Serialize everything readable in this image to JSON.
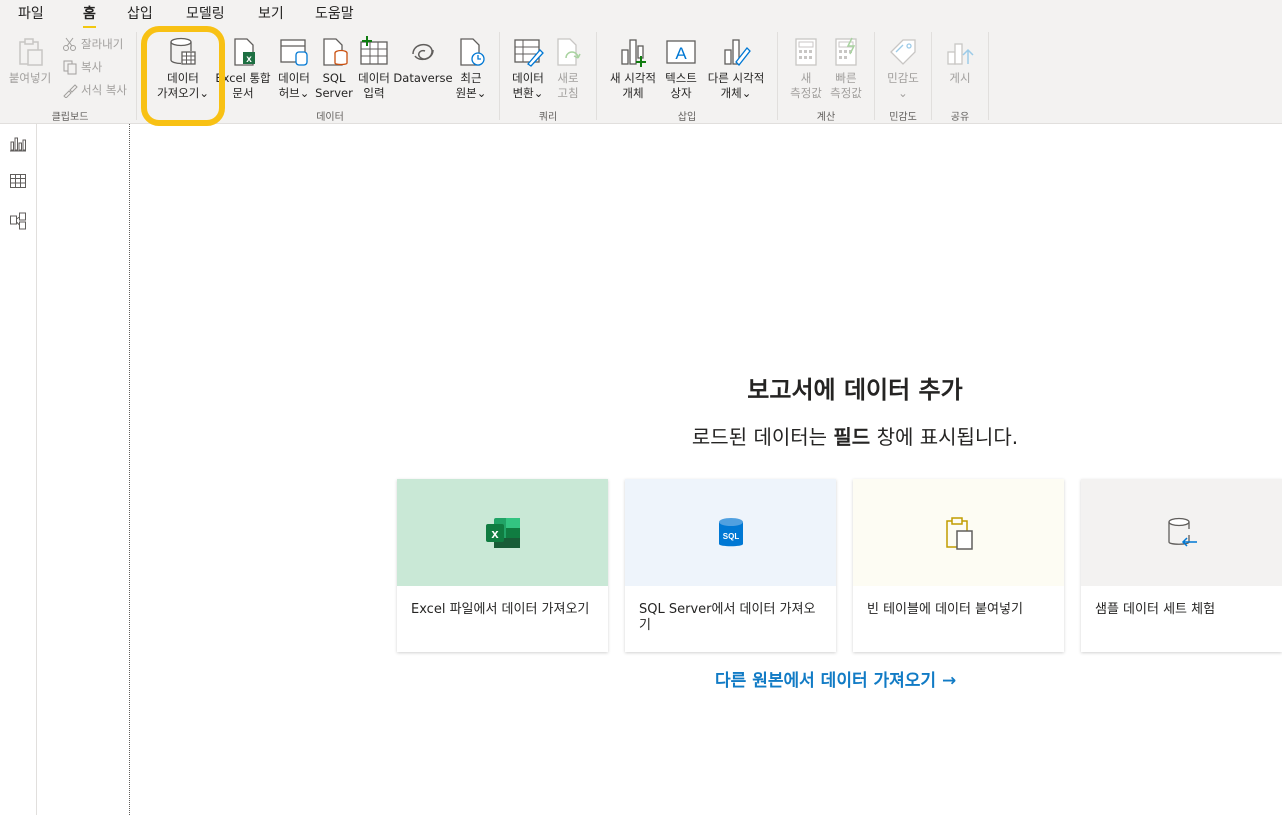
{
  "menu": {
    "tabs": [
      "파일",
      "홈",
      "삽입",
      "모델링",
      "보기",
      "도움말"
    ],
    "active": "홈"
  },
  "ribbon": {
    "clipboard": {
      "paste": "붙여넣기",
      "cut": "잘라내기",
      "copy": "복사",
      "format_painter": "서식 복사",
      "group": "클립보드"
    },
    "data": {
      "get_data_line1": "데이터",
      "get_data_line2": "가져오기⌄",
      "excel_line1": "Excel 통합",
      "excel_line2": "문서",
      "hub_line1": "데이터",
      "hub_line2": "허브⌄",
      "sql_line1": "SQL",
      "sql_line2": "Server",
      "enter_line1": "데이터",
      "enter_line2": "입력",
      "dataverse": "Dataverse",
      "recent_line1": "최근",
      "recent_line2": "원본⌄",
      "group": "데이터"
    },
    "query": {
      "transform_line1": "데이터",
      "transform_line2": "변환⌄",
      "refresh_line1": "새로",
      "refresh_line2": "고침",
      "group": "쿼리"
    },
    "insert": {
      "visual_line1": "새 시각적",
      "visual_line2": "개체",
      "textbox_line1": "텍스트",
      "textbox_line2": "상자",
      "more_line1": "다른 시각적",
      "more_line2": "개체⌄",
      "group": "삽입"
    },
    "calc": {
      "new_line1": "새",
      "new_line2": "측정값",
      "quick_line1": "빠른",
      "quick_line2": "측정값",
      "group": "계산"
    },
    "sensitivity": {
      "label": "민감도",
      "chevron": "⌄",
      "group": "민감도"
    },
    "share": {
      "publish": "게시",
      "group": "공유"
    }
  },
  "canvas": {
    "heading": "보고서에 데이터 추가",
    "sub_before": "로드된 데이터는 ",
    "sub_bold": "필드",
    "sub_after": " 창에 표시됩니다.",
    "cards": [
      {
        "label": "Excel 파일에서 데이터 가져오기",
        "color": "#c9e8d6"
      },
      {
        "label": "SQL Server에서 데이터 가져오기",
        "color": "#eef4fb"
      },
      {
        "label": "빈 테이블에 데이터 붙여넣기",
        "color": "#fdfcf3"
      },
      {
        "label": "샘플 데이터 세트 체험",
        "color": "#f3f2f1"
      }
    ],
    "more_link": "다른 원본에서 데이터 가져오기 →"
  },
  "colors": {
    "accent": "#f2c811",
    "highlight": "#f8c114",
    "link": "#117bc5",
    "excel_green": "#1d6f42",
    "sql_blue": "#0078d4"
  }
}
